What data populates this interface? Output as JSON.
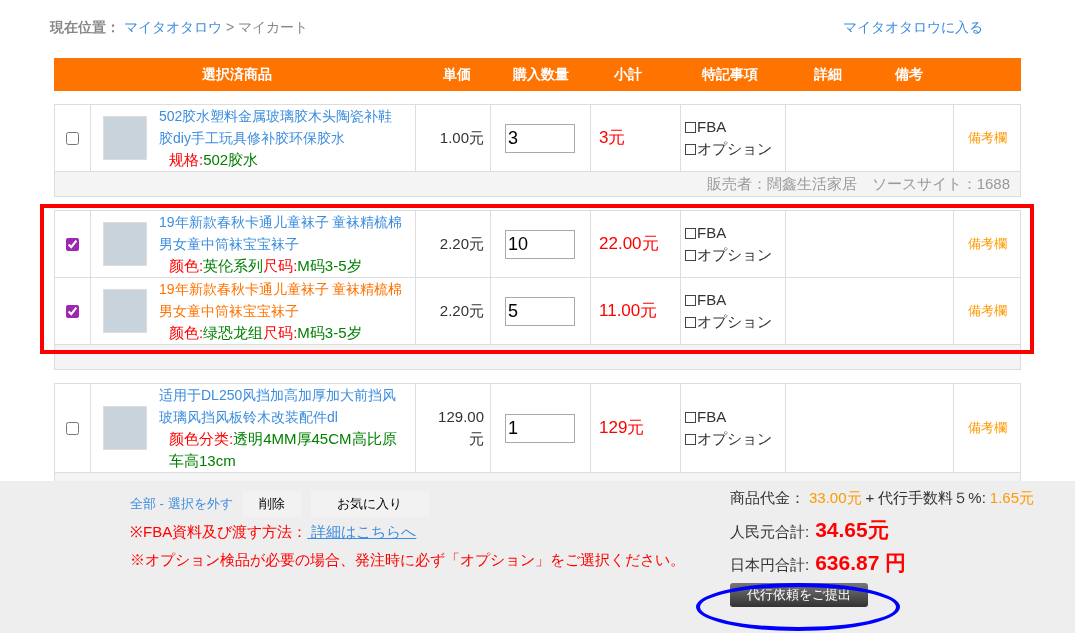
{
  "breadcrumb": {
    "label": "現在位置：",
    "items": [
      "マイタオタロウ",
      "マイカート"
    ],
    "separator": ">"
  },
  "top_link": "マイタオタロウに入る",
  "table": {
    "columns": [
      "選択済商品",
      "単価",
      "購入数量",
      "小計",
      "特記事項",
      "詳細",
      "備考"
    ],
    "groups": [
      {
        "items": [
          {
            "selected": false,
            "hovered": false,
            "title": "502胶水塑料金属玻璃胶木头陶瓷补鞋胶diy手工玩具修补胶环保胶水",
            "specs": [
              {
                "key": "规格:",
                "value": "502胶水"
              }
            ],
            "unit_price": "1.00元",
            "quantity": "3",
            "subtotal": "3元",
            "options": [
              {
                "label": "FBA",
                "checked": false
              },
              {
                "label": "オプション",
                "checked": false
              }
            ],
            "remark": "備考欄"
          }
        ],
        "seller": "販売者：闊鑫生活家居　ソースサイト：1688"
      },
      {
        "items": [
          {
            "selected": true,
            "hovered": false,
            "title": "19年新款春秋卡通儿童袜子 童袜精梳棉男女童中筒袜宝宝袜子",
            "specs": [
              {
                "key": "颜色:",
                "value": "英伦系列"
              },
              {
                "key": "尺码:",
                "value": "M码3-5岁"
              }
            ],
            "unit_price": "2.20元",
            "quantity": "10",
            "subtotal": "22.00元",
            "options": [
              {
                "label": "FBA",
                "checked": false
              },
              {
                "label": "オプション",
                "checked": false
              }
            ],
            "remark": "備考欄"
          },
          {
            "selected": true,
            "hovered": true,
            "title": "19年新款春秋卡通儿童袜子 童袜精梳棉男女童中筒袜宝宝袜子",
            "specs": [
              {
                "key": "颜色:",
                "value": "绿恐龙组"
              },
              {
                "key": "尺码:",
                "value": "M码3-5岁"
              }
            ],
            "unit_price": "2.20元",
            "quantity": "5",
            "subtotal": "11.00元",
            "options": [
              {
                "label": "FBA",
                "checked": false
              },
              {
                "label": "オプション",
                "checked": false
              }
            ],
            "remark": "備考欄"
          }
        ]
      },
      {
        "items": [
          {
            "selected": false,
            "hovered": false,
            "title": "适用于DL250风挡加高加厚加大前挡风玻璃风挡风板铃木改装配件dl",
            "specs": [
              {
                "key": "颜色分类:",
                "value": "透明4MM厚45CM高比原车高13cm"
              }
            ],
            "unit_price": "129.00元",
            "quantity": "1",
            "subtotal": "129元",
            "options": [
              {
                "label": "FBA",
                "checked": false
              },
              {
                "label": "オプション",
                "checked": false
              }
            ],
            "remark": "備考欄"
          }
        ]
      }
    ]
  },
  "footer": {
    "select_link": "全部 - 選択を外す",
    "buttons": [
      "削除",
      "お気に入り"
    ],
    "notes": [
      {
        "text": "※FBA資料及び渡す方法：",
        "link": " 詳細はこちらへ"
      },
      {
        "text": "※オプション検品が必要の場合、発注時に必ず「オプション」をご選択ください。"
      }
    ],
    "summary": {
      "goods_label": "商品代金：",
      "goods_value": "33.00元",
      "plus": "+",
      "fee_label": "代行手数料５%:",
      "fee_value": "1.65元",
      "rmb_label": "人民元合計:",
      "rmb_value": "34.65元",
      "jpy_label": "日本円合計:",
      "jpy_value": "636.87 円"
    },
    "submit": "代行依頼をご提出"
  },
  "annotations": [
    {
      "kind": "rectangle",
      "color": "#ff0000"
    },
    {
      "kind": "ellipse",
      "color": "#0000ff"
    }
  ]
}
